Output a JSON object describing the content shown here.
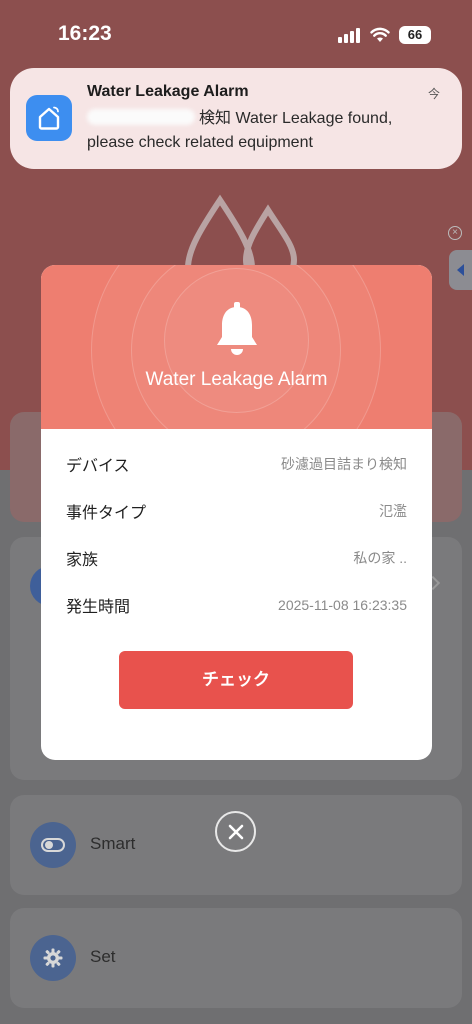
{
  "status_bar": {
    "time": "16:23",
    "battery": "66"
  },
  "notification": {
    "title": "Water Leakage Alarm",
    "time": "今",
    "body": "検知 Water Leakage found, please check related equipment",
    "icon": "smart-home-icon",
    "icon_color": "#3d8ef0"
  },
  "dialog": {
    "title": "Water Leakage Alarm",
    "header_color": "#ee7e70",
    "rows": [
      {
        "label": "デバイス",
        "value": "砂濾過目詰まり検知"
      },
      {
        "label": "事件タイプ",
        "value": "氾濫"
      },
      {
        "label": "家族",
        "value": "私の家 .."
      },
      {
        "label": "発生時間",
        "value": "2025-11-08 16:23:35"
      }
    ],
    "check_button": "チェック",
    "button_color": "#e8524d"
  },
  "background_app": {
    "items": [
      {
        "label": "Smart",
        "icon": "toggle-icon"
      },
      {
        "label": "Set",
        "icon": "gear-icon"
      }
    ]
  }
}
